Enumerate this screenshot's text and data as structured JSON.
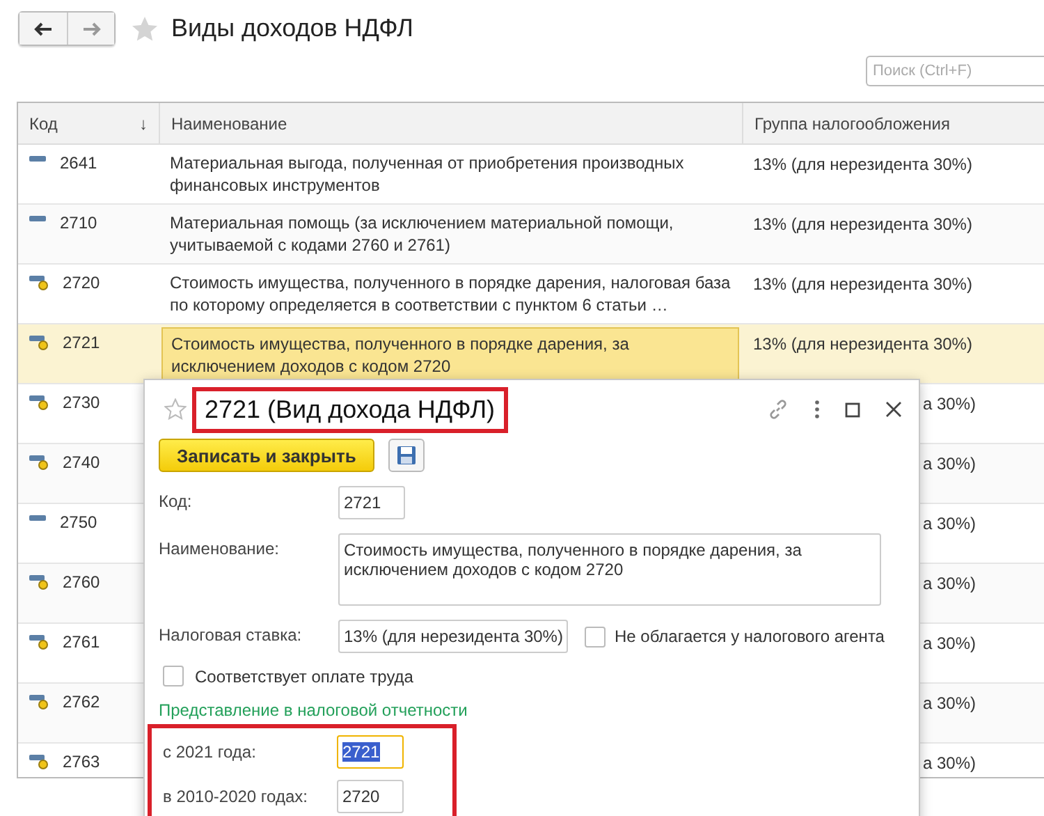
{
  "header": {
    "title": "Виды доходов НДФЛ",
    "search_placeholder": "Поиск (Ctrl+F)"
  },
  "table": {
    "columns": [
      {
        "label": "Код",
        "sort": "↓"
      },
      {
        "label": "Наименование"
      },
      {
        "label": "Группа налогообложения"
      }
    ],
    "rows": [
      {
        "kind": "plain",
        "code": "2641",
        "name": "Материальная выгода, полученная от приобретения производных финансовых инструментов",
        "group": "13% (для нерезидента 30%)",
        "selected": false
      },
      {
        "kind": "plain",
        "code": "2710",
        "name": "Материальная помощь (за исключением материальной помощи, учитываемой с кодами 2760 и 2761)",
        "group": "13% (для нерезидента 30%)",
        "selected": false
      },
      {
        "kind": "linked",
        "code": "2720",
        "name": "Стоимость имущества, полученного в порядке дарения, налоговая база по которому определяется в соответствии с пунктом 6 статьи …",
        "group": "13% (для нерезидента 30%)",
        "selected": false
      },
      {
        "kind": "linked",
        "code": "2721",
        "name": "Стоимость имущества, полученного в порядке дарения, за исключением доходов с кодом 2720",
        "group": "13% (для нерезидента 30%)",
        "selected": true
      },
      {
        "kind": "linked",
        "code": "2730",
        "group": "а 30%)",
        "selected": false
      },
      {
        "kind": "linked",
        "code": "2740",
        "group": "а 30%)",
        "selected": false
      },
      {
        "kind": "plain",
        "code": "2750",
        "group": "а 30%)",
        "selected": false
      },
      {
        "kind": "linked",
        "code": "2760",
        "group": "а 30%)",
        "selected": false
      },
      {
        "kind": "linked",
        "code": "2761",
        "group": "а 30%)",
        "selected": false
      },
      {
        "kind": "linked",
        "code": "2762",
        "group": "а 30%)",
        "selected": false
      },
      {
        "kind": "linked",
        "code": "2763",
        "group": "а 30%)",
        "selected": false
      }
    ]
  },
  "dialog": {
    "title": "2721 (Вид дохода НДФЛ)",
    "title_highlighted": true,
    "save_close_button": "Записать и закрыть",
    "code_label": "Код:",
    "code_value": "2721",
    "name_label": "Наименование:",
    "name_value": "Стоимость имущества, полученного в порядке дарения, за исключением доходов с кодом 2720",
    "rate_label": "Налоговая ставка:",
    "rate_value": "13% (для нерезидента 30%)",
    "not_taxed": {
      "label": "Не облагается у налогового агента",
      "checked": false
    },
    "labor_payment": {
      "label": "Соответствует оплате труда",
      "checked": false
    },
    "reporting": {
      "heading": "Представление в налоговой отчетности",
      "highlighted": true,
      "fields": [
        {
          "label": "с 2021 года:",
          "value": "2721",
          "selected": true
        },
        {
          "label": "в 2010-2020 годах:",
          "value": "2720",
          "selected": false
        }
      ]
    }
  }
}
